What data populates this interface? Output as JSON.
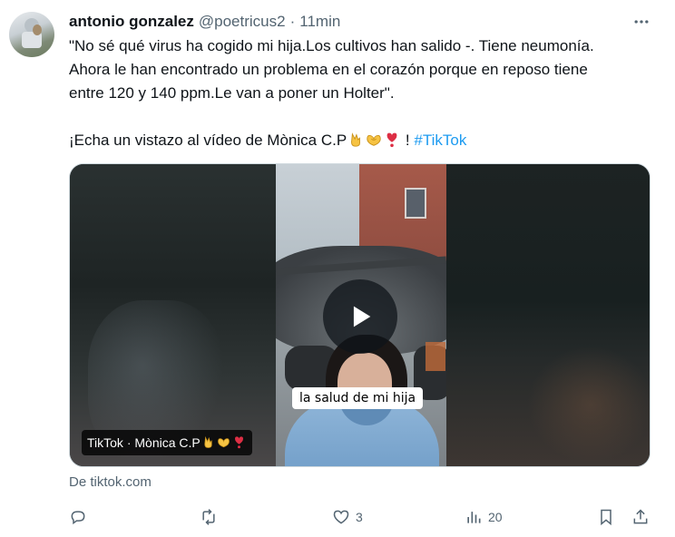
{
  "tweet": {
    "author_name": "antonio gonzalez",
    "handle": "@poetricus2",
    "separator": "·",
    "time": "11min",
    "text_line1": "\"No sé qué virus ha cogido mi hija.Los cultivos han salido -. Tiene neumonía.",
    "text_line2": "Ahora le han encontrado un problema en el corazón porque en reposo tiene",
    "text_line3": "entre 120 y 140 ppm.Le van a poner un Holter\".",
    "cta_prefix": "¡Echa un vistazo al vídeo de Mònica C.P",
    "cta_suffix": "!",
    "hashtag": "#TikTok"
  },
  "media": {
    "caption": "la salud de mi hija",
    "label": "TikTok · Mònica C.P",
    "play_icon": "play-icon"
  },
  "source": "De tiktok.com",
  "actions": {
    "reply_icon": "reply-icon",
    "retweet_icon": "retweet-icon",
    "like_icon": "heart-icon",
    "like_count": "3",
    "views_icon": "views-icon",
    "view_count": "20",
    "bookmark_icon": "bookmark-icon",
    "share_icon": "share-icon"
  },
  "colors": {
    "accent": "#1d9bf0",
    "text": "#0f1419",
    "secondary": "#536471"
  }
}
